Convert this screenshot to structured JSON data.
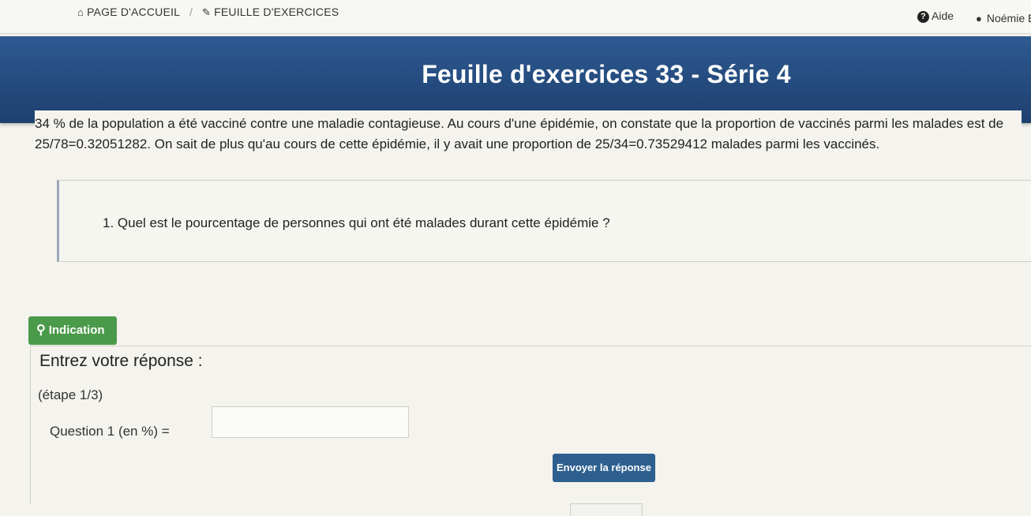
{
  "nav": {
    "home_label": "PAGE D'ACCUEIL",
    "separator": "/",
    "sheet_label": "FEUILLE D'EXERCICES",
    "help_label": "Aide",
    "user_name": "Noémie E"
  },
  "exercise": {
    "title": "Feuille d'exercices 33 - Série 4",
    "statement_line1": "34 % de la population a été vacciné contre une maladie contagieuse. Au cours d'une épidémie, on constate que la proportion de vaccinés parmi les malades est de",
    "statement_line2": "25/78=0.32051282. On sait de plus qu'au cours de cette épidémie, il y avait une proportion de 25/34=0.73529412 malades parmi les vaccinés.",
    "question": "1. Quel est le pourcentage de personnes qui ont été malades durant cette épidémie ?"
  },
  "answer": {
    "hint_label": "Indication",
    "legend": "Entrez votre réponse :",
    "step": "(étape 1/3)",
    "question_label": "Question 1 (en %) =",
    "input_value": "",
    "submit_label": "Envoyer la réponse"
  },
  "icons": {
    "home": "home-icon",
    "edit": "edit-icon",
    "help": "help-icon",
    "user": "user-icon",
    "hint": "lightbulb-icon"
  },
  "colors": {
    "banner": "#244b7e",
    "hint_button": "#4a9a4a",
    "submit_button": "#2d5f8f"
  }
}
